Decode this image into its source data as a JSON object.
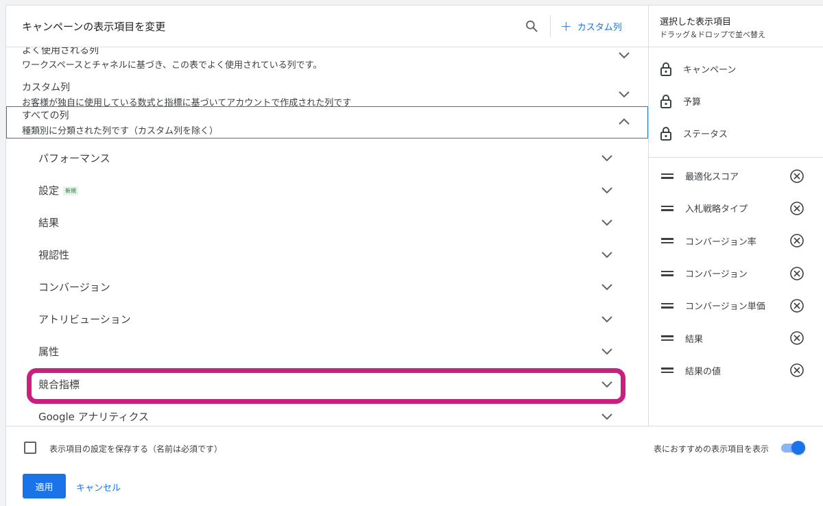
{
  "header": {
    "title": "キャンペーンの表示項目を変更",
    "custom_column_label": "カスタム列"
  },
  "groups": [
    {
      "title": "よく使用される列",
      "description": "ワークスペースとチャネルに基づき、この表でよく使用されている列です。",
      "expanded": false
    },
    {
      "title": "カスタム列",
      "description": "お客様が独自に使用している数式と指標に基づいてアカウントで作成された列です",
      "expanded": false
    },
    {
      "title": "すべての列",
      "description": "種類別に分類された列です（カスタム列を除く）",
      "expanded": true
    }
  ],
  "categories": [
    {
      "label": "パフォーマンス"
    },
    {
      "label": "設定",
      "badge": "新規"
    },
    {
      "label": "結果"
    },
    {
      "label": "視認性"
    },
    {
      "label": "コンバージョン"
    },
    {
      "label": "アトリビューション"
    },
    {
      "label": "属性"
    },
    {
      "label": "競合指標",
      "highlighted": true
    },
    {
      "label": "Google アナリティクス"
    }
  ],
  "selected_panel": {
    "title": "選択した表示項目",
    "subtitle": "ドラッグ＆ドロップで並べ替え",
    "locked": [
      "キャンペーン",
      "予算",
      "ステータス"
    ],
    "items": [
      "最適化スコア",
      "入札戦略タイプ",
      "コンバージョン率",
      "コンバージョン",
      "コンバージョン単価",
      "結果",
      "結果の値"
    ]
  },
  "footer": {
    "save_label": "表示項目の設定を保存する（名前は必須です）",
    "recommend_label": "表におすすめの表示項目を表示",
    "recommend_enabled": true,
    "save_checked": false,
    "apply_label": "適用",
    "cancel_label": "キャンセル"
  },
  "colors": {
    "accent": "#1a73e8",
    "highlight": "#c8207f",
    "new_badge": "#188038"
  }
}
